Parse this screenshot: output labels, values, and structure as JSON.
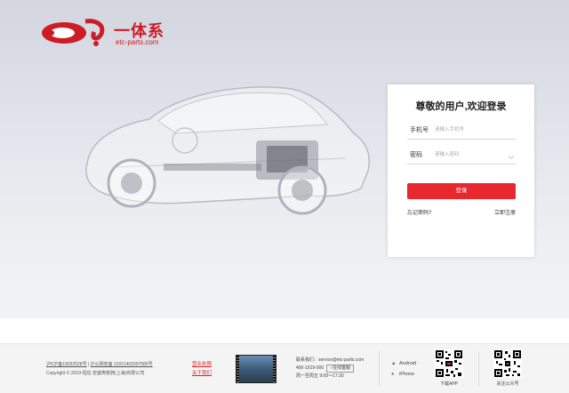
{
  "logo": {
    "brand": "一体系",
    "domain": "etc-parts.com"
  },
  "login": {
    "title": "尊敬的用户,欢迎登录",
    "phone_label": "手机号",
    "phone_placeholder": "请输入手机号",
    "password_label": "密码",
    "password_placeholder": "请输入密码",
    "submit_label": "登录",
    "forgot_label": "忘记密码?",
    "register_label": "立即注册"
  },
  "footer": {
    "icp": "沪ICP备19032528号",
    "police": "沪公网安备 31011402007585号",
    "copyright": "Copyright © 2019-恒佐 宏盛寿衡骑(上海)有限公司",
    "links": [
      "营业执照",
      "关于我们"
    ],
    "contact_label": "联系我们：",
    "contact_email": "service@etc-parts.com",
    "phone": "400-1919-000",
    "online_service": "在线客服",
    "hours": "周一至周五 9:00～17:30",
    "apps": [
      "Android",
      "iPhone"
    ],
    "qr_labels": [
      "下载APP",
      "关注公众号"
    ]
  },
  "colors": {
    "brand": "#cc1c26",
    "button": "#e8282e"
  }
}
